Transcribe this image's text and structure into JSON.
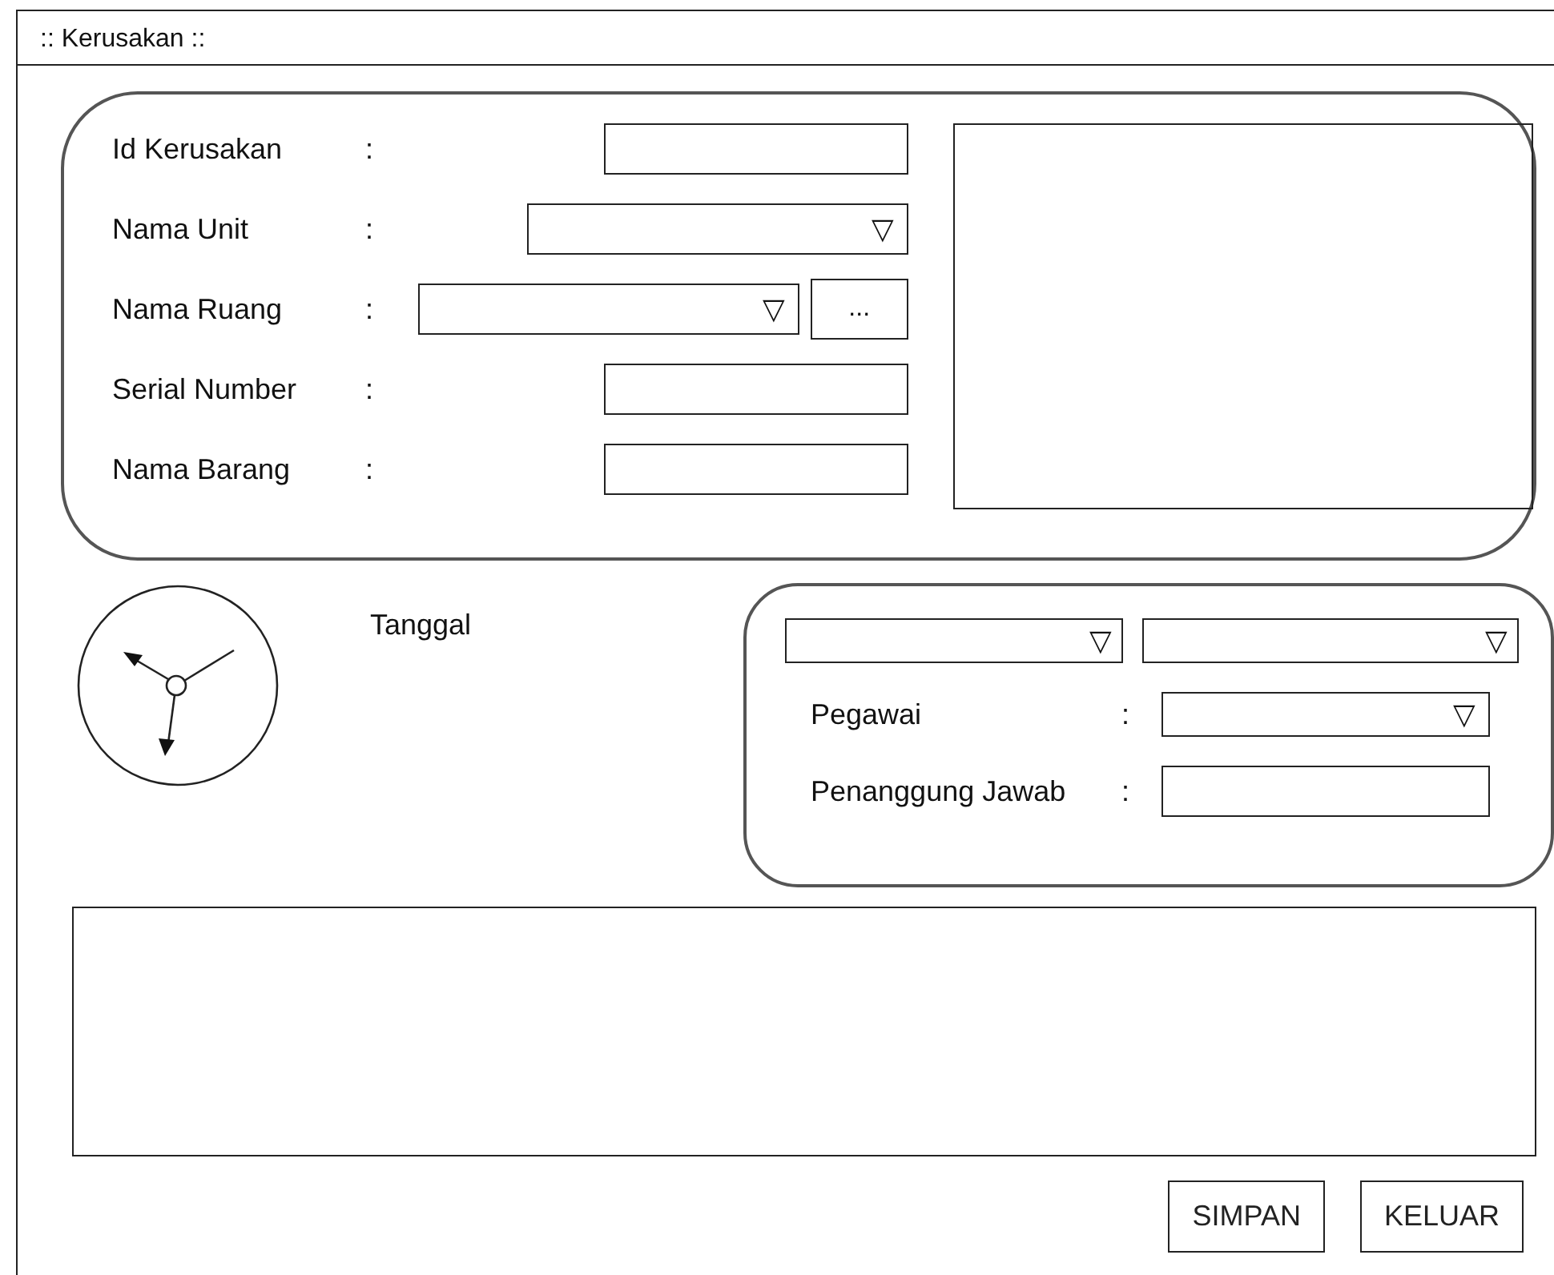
{
  "window": {
    "title": ":: Kerusakan ::"
  },
  "details": {
    "fields": [
      {
        "label": "Id Kerusakan",
        "separator": ":",
        "kind": "text"
      },
      {
        "label": "Nama Unit",
        "separator": ":",
        "kind": "dropdown",
        "arrow": "▽"
      },
      {
        "label": "Nama Ruang",
        "separator": ":",
        "kind": "dropdown",
        "arrow": "▽",
        "extra_button": "..."
      },
      {
        "label": "Serial Number",
        "separator": ":",
        "kind": "text"
      },
      {
        "label": "Nama Barang",
        "separator": ":",
        "kind": "text"
      }
    ]
  },
  "date": {
    "label": "Tanggal"
  },
  "staff": {
    "dropdowns": [
      {
        "arrow": "▽"
      },
      {
        "arrow": "▽"
      }
    ],
    "fields": [
      {
        "label": "Pegawai",
        "separator": ":",
        "kind": "dropdown",
        "arrow": "▽"
      },
      {
        "label": "Penanggung Jawab",
        "separator": ":",
        "kind": "text"
      }
    ]
  },
  "buttons": [
    "SIMPAN",
    "KELUAR"
  ]
}
